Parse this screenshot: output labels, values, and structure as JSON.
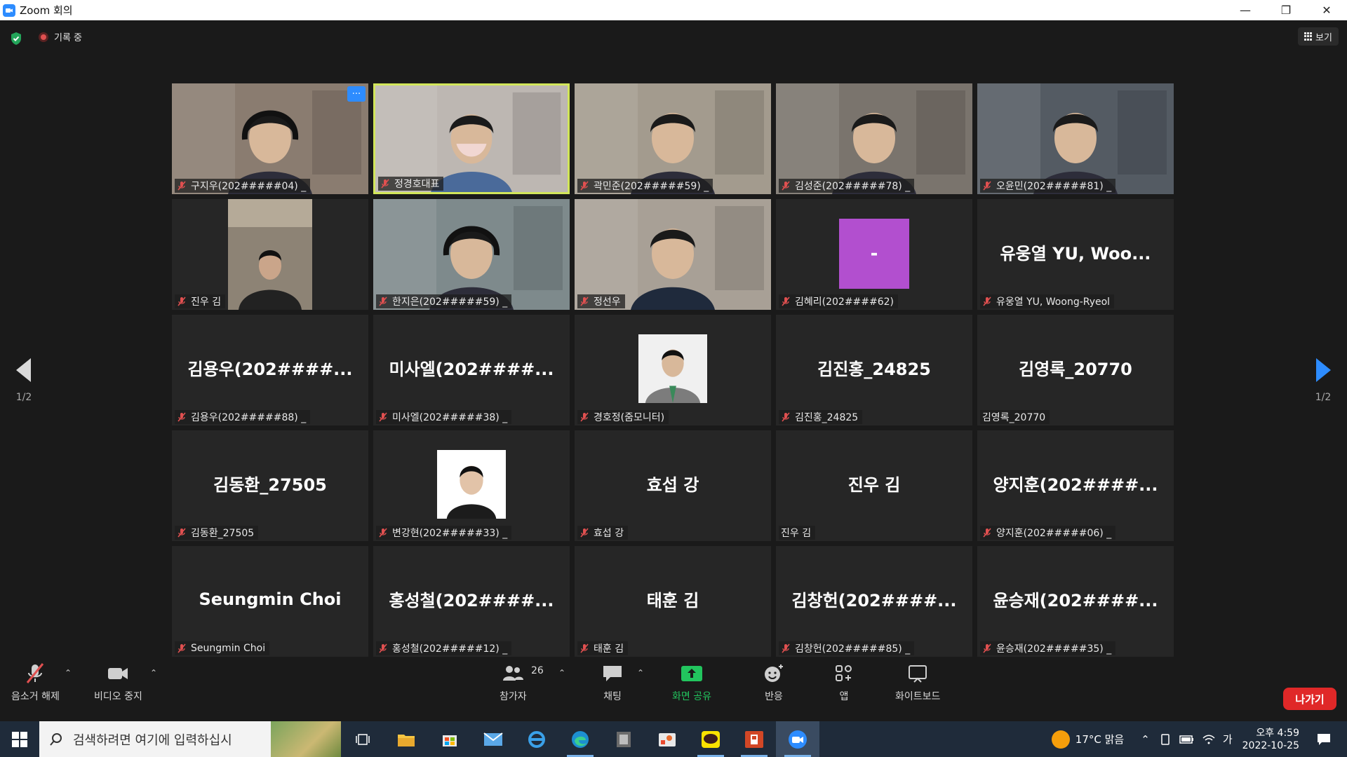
{
  "window": {
    "title": "Zoom 회의",
    "controls": [
      "minimize",
      "restore",
      "close"
    ]
  },
  "topbar": {
    "recording_label": "기록 중",
    "view_label": "보기"
  },
  "pager": {
    "left_label": "1/2",
    "right_label": "1/2"
  },
  "tiles": [
    {
      "label": "구지우(202#####04) _",
      "big": "",
      "kind": "video",
      "bg": "#8a7c70",
      "more": "···"
    },
    {
      "label": "정경호대표",
      "big": "",
      "kind": "video",
      "bg": "#bdb7b2",
      "active": true
    },
    {
      "label": "곽민준(202#####59) _",
      "big": "",
      "kind": "video",
      "bg": "#a39b8e"
    },
    {
      "label": "김성준(202#####78) _",
      "big": "",
      "kind": "video",
      "bg": "#7a746d"
    },
    {
      "label": "오윤민(202#####81) _",
      "big": "",
      "kind": "video",
      "bg": "#545b63"
    },
    {
      "label": "진우 김",
      "big": "",
      "kind": "video-narrow",
      "bg": "#8d8375"
    },
    {
      "label": "한지은(202#####59) _",
      "big": "",
      "kind": "video",
      "bg": "#7e8a8c"
    },
    {
      "label": "정선우",
      "big": "",
      "kind": "video",
      "bg": "#a8a096"
    },
    {
      "label": "김혜리(202####62)",
      "big": "",
      "kind": "avatar",
      "avatar_text": "-"
    },
    {
      "label": "유웅열 YU, Woong-Ryeol",
      "big": "유웅열 YU, Woo...",
      "kind": "name"
    },
    {
      "label": "김용우(202#####88) _",
      "big": "김용우(202####...",
      "kind": "name"
    },
    {
      "label": "미사엘(202#####38) _",
      "big": "미사엘(202####...",
      "kind": "name"
    },
    {
      "label": "경호정(줌모니터)",
      "big": "",
      "kind": "photo-suit"
    },
    {
      "label": "김진홍_24825",
      "big": "김진홍_24825",
      "kind": "name"
    },
    {
      "label": "김영록_20770",
      "big": "김영록_20770",
      "kind": "name",
      "no_mute": true
    },
    {
      "label": "김동환_27505",
      "big": "김동환_27505",
      "kind": "name"
    },
    {
      "label": "변강현(202#####33) _",
      "big": "",
      "kind": "photo-white"
    },
    {
      "label": "효섭 강",
      "big": "효섭 강",
      "kind": "name"
    },
    {
      "label": "진우 김",
      "big": "진우 김",
      "kind": "name",
      "no_mute": true
    },
    {
      "label": "양지훈(202#####06) _",
      "big": "양지훈(202####...",
      "kind": "name"
    },
    {
      "label": "Seungmin Choi",
      "big": "Seungmin Choi",
      "kind": "name"
    },
    {
      "label": "홍성철(202#####12) _",
      "big": "홍성철(202####...",
      "kind": "name"
    },
    {
      "label": "태훈 김",
      "big": "태훈 김",
      "kind": "name"
    },
    {
      "label": "김창헌(202#####85) _",
      "big": "김창헌(202####...",
      "kind": "name"
    },
    {
      "label": "윤승재(202#####35) _",
      "big": "윤승재(202####...",
      "kind": "name"
    }
  ],
  "toolbar": {
    "unmute": "음소거 해제",
    "stop_video": "비디오 중지",
    "participants": "참가자",
    "participants_count": "26",
    "chat": "채팅",
    "share_screen": "화면 공유",
    "reactions": "반응",
    "apps": "앱",
    "whiteboard": "화이트보드",
    "leave": "나가기"
  },
  "taskbar": {
    "search_placeholder": "검색하려면 여기에 입력하십시",
    "weather": "17°C  맑음",
    "ime": "가",
    "time": "오후 4:59",
    "date": "2022-10-25"
  },
  "colors": {
    "accent": "#2d8cff",
    "active_border": "#d2e65a",
    "leave": "#e02828",
    "share": "#22c55e",
    "mute": "#e05050"
  }
}
